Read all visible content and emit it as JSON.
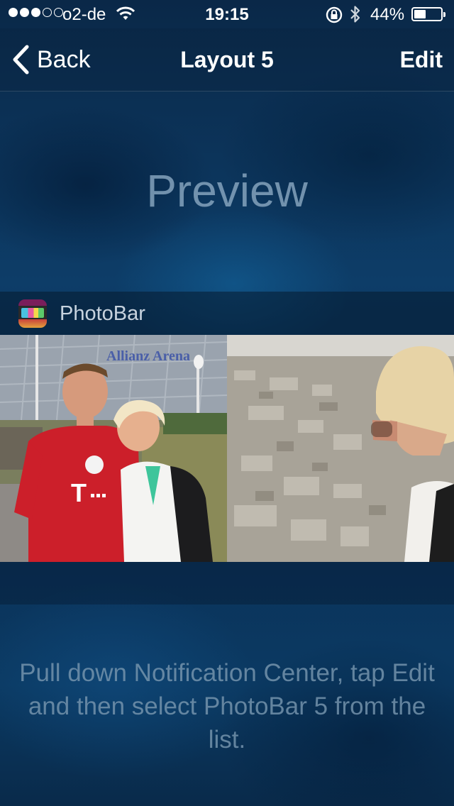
{
  "status_bar": {
    "carrier": "o2-de",
    "time": "19:15",
    "battery_percent": "44%",
    "battery_level": 0.44,
    "signal_bars_filled": 3,
    "signal_bars_total": 5
  },
  "nav": {
    "back_label": "Back",
    "title": "Layout 5",
    "edit_label": "Edit"
  },
  "preview": {
    "label": "Preview"
  },
  "widget": {
    "name": "PhotoBar",
    "photos": [
      {
        "description_icon": "photo-couple-stadium"
      },
      {
        "description_icon": "photo-city-view"
      }
    ]
  },
  "instructions": {
    "text": "Pull down Notification Center, tap Edit and then select PhotoBar 5 from the list."
  },
  "colors": {
    "background": "#0b2b4a",
    "text_primary": "#ffffff",
    "text_muted": "#7896af"
  }
}
